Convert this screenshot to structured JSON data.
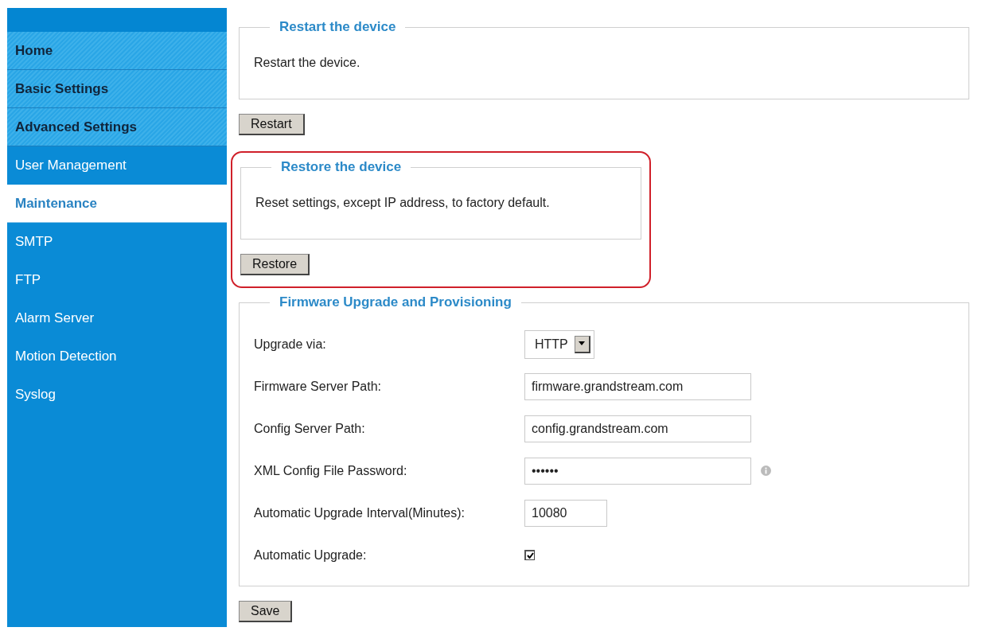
{
  "sidebar": {
    "items": [
      {
        "label": "Home",
        "kind": "section",
        "selected": false
      },
      {
        "label": "Basic Settings",
        "kind": "section",
        "selected": false
      },
      {
        "label": "Advanced Settings",
        "kind": "section",
        "selected": false
      },
      {
        "label": "User Management",
        "kind": "sub",
        "selected": false
      },
      {
        "label": "Maintenance",
        "kind": "sub",
        "selected": true
      },
      {
        "label": "SMTP",
        "kind": "sub",
        "selected": false
      },
      {
        "label": "FTP",
        "kind": "sub",
        "selected": false
      },
      {
        "label": "Alarm Server",
        "kind": "sub",
        "selected": false
      },
      {
        "label": "Motion Detection",
        "kind": "sub",
        "selected": false
      },
      {
        "label": "Syslog",
        "kind": "sub",
        "selected": false
      }
    ]
  },
  "sections": [
    {
      "title": "Restart the device",
      "description": "Restart the device.",
      "button": "Restart",
      "highlighted": false
    },
    {
      "title": "Restore the device",
      "description": "Reset settings, except IP address, to factory default.",
      "button": "Restore",
      "highlighted": true
    }
  ],
  "firmware": {
    "title": "Firmware Upgrade and Provisioning",
    "fields": [
      {
        "label": "Upgrade via:",
        "kind": "select",
        "value": "HTTP"
      },
      {
        "label": "Firmware Server Path:",
        "kind": "text",
        "value": "firmware.grandstream.com"
      },
      {
        "label": "Config Server Path:",
        "kind": "text",
        "value": "config.grandstream.com"
      },
      {
        "label": "XML Config File Password:",
        "kind": "password",
        "value": "••••••"
      },
      {
        "label": "Automatic Upgrade Interval(Minutes):",
        "kind": "short",
        "value": "10080"
      },
      {
        "label": "Automatic Upgrade:",
        "kind": "checkbox",
        "checked": true
      }
    ]
  },
  "save_button": "Save"
}
